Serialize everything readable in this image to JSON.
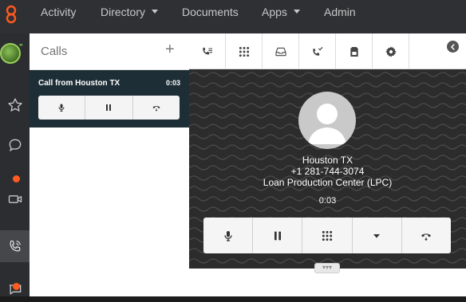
{
  "nav": {
    "items": [
      {
        "label": "Activity"
      },
      {
        "label": "Directory",
        "dropdown": true
      },
      {
        "label": "Documents"
      },
      {
        "label": "Apps",
        "dropdown": true
      },
      {
        "label": "Admin"
      }
    ]
  },
  "rail": {
    "presence_marker": "\"",
    "items": [
      {
        "icon": "star-icon"
      },
      {
        "icon": "chat-icon",
        "badge": true
      },
      {
        "icon": "video-icon"
      },
      {
        "icon": "phone-ringing-icon",
        "active": true
      },
      {
        "icon": "message-icon",
        "badge": true
      }
    ]
  },
  "calls_panel": {
    "title": "Calls",
    "add_label": "+",
    "active_call": {
      "name": "Call from Houston TX",
      "duration": "0:03"
    }
  },
  "call_view": {
    "caller_location": "Houston TX",
    "caller_number": "+1 281-744-3074",
    "caller_department": "Loan Production Center (LPC)",
    "duration": "0:03",
    "expand_handle": "▾▾▾"
  },
  "colors": {
    "nav_bg": "#2f3033",
    "accent_orange": "#ff5a1f",
    "call_card_bg": "#1e2e36",
    "stage_bg": "#2c2c2c"
  }
}
